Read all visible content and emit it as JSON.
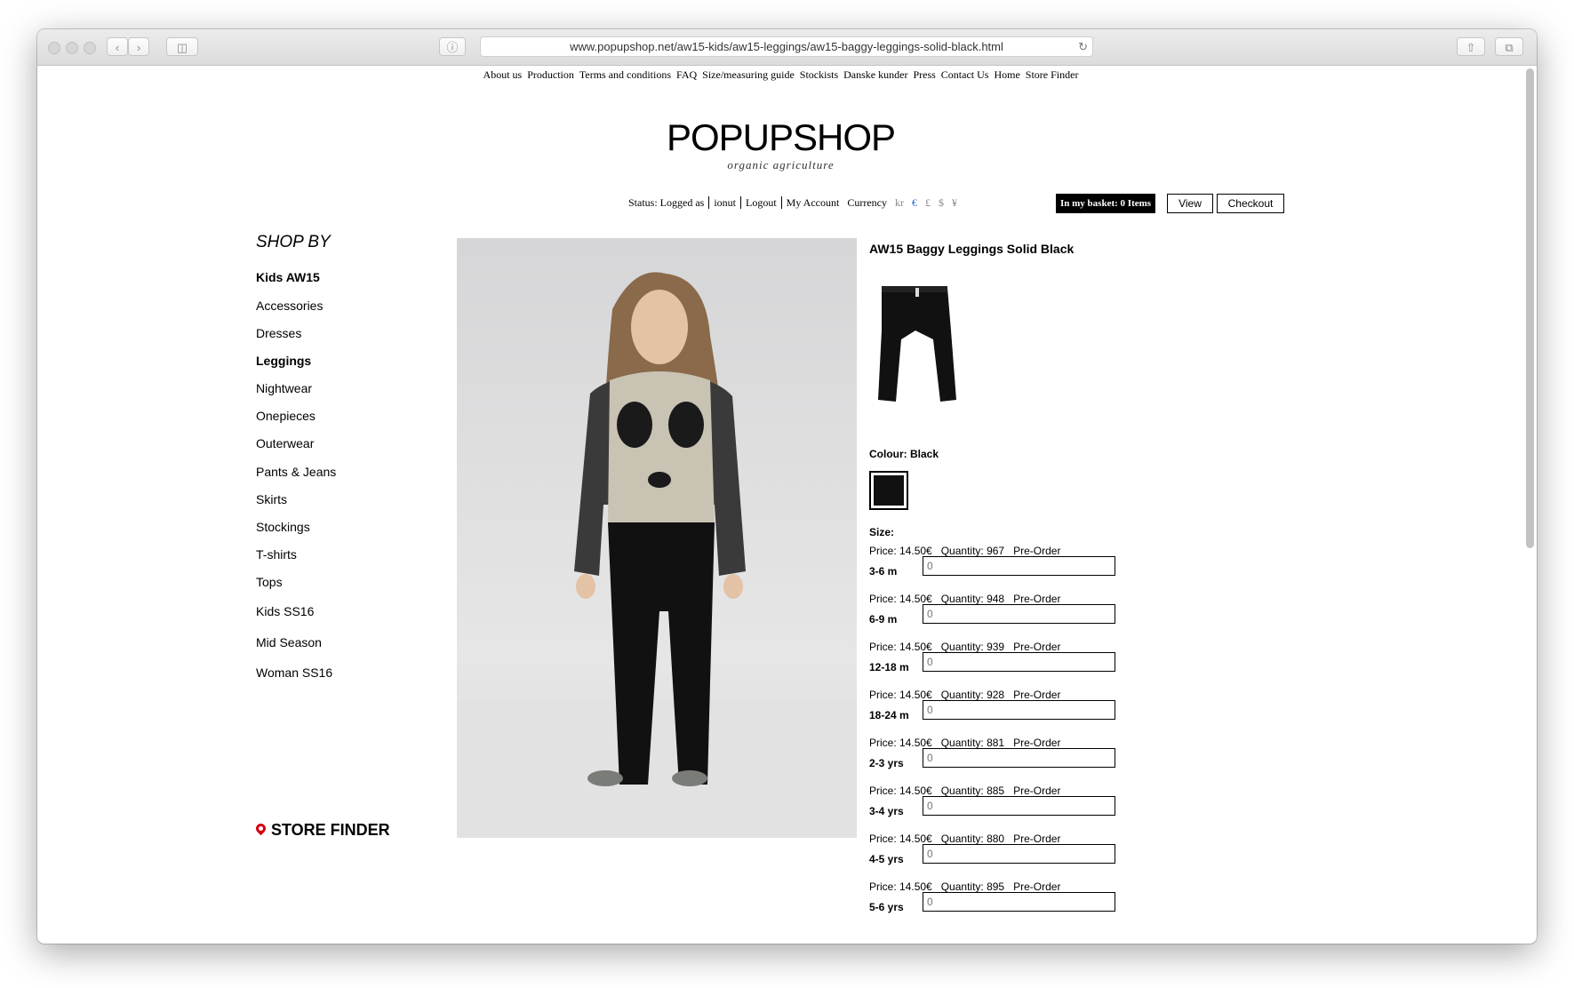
{
  "browser": {
    "url": "www.popupshop.net/aw15-kids/aw15-leggings/aw15-baggy-leggings-solid-black.html"
  },
  "topnav": [
    "About us",
    "Production",
    "Terms and conditions",
    "FAQ",
    "Size/measuring guide",
    "Stockists",
    "Danske kunder",
    "Press",
    "Contact Us",
    "Home",
    "Store Finder"
  ],
  "brand": {
    "logo": "POPUPSHOP",
    "tagline": "organic agriculture"
  },
  "account": {
    "status": "Status: Logged as",
    "user": "ionut",
    "logout": "Logout",
    "my_account": "My Account",
    "currency_label": "Currency",
    "currencies": [
      "kr",
      "€",
      "£",
      "$",
      "¥"
    ],
    "active_currency": "€"
  },
  "basket": {
    "label": "In my basket: 0 Items",
    "view": "View",
    "checkout": "Checkout"
  },
  "sidebar": {
    "heading": "SHOP BY",
    "items": [
      {
        "label": "Kids AW15",
        "bold": true
      },
      {
        "label": "Accessories"
      },
      {
        "label": "Dresses"
      },
      {
        "label": "Leggings",
        "bold": true
      },
      {
        "label": "Nightwear"
      },
      {
        "label": "Onepieces"
      },
      {
        "label": "Outerwear"
      },
      {
        "label": "Pants & Jeans"
      },
      {
        "label": "Skirts"
      },
      {
        "label": "Stockings"
      },
      {
        "label": "T-shirts"
      },
      {
        "label": "Tops"
      },
      {
        "label": "Kids SS16"
      },
      {
        "label": "Mid Season"
      },
      {
        "label": "Woman SS16"
      }
    ],
    "store_finder": "STORE FINDER"
  },
  "product": {
    "title": "AW15 Baggy Leggings Solid Black",
    "colour_label": "Colour: Black",
    "swatch_color": "#111111",
    "size_label": "Size:",
    "sizes": [
      {
        "price": "Price: 14.50€",
        "quantity": "Quantity: 967",
        "status": "Pre-Order",
        "size": "3-6 m",
        "value": "0"
      },
      {
        "price": "Price: 14.50€",
        "quantity": "Quantity: 948",
        "status": "Pre-Order",
        "size": "6-9 m",
        "value": "0"
      },
      {
        "price": "Price: 14.50€",
        "quantity": "Quantity: 939",
        "status": "Pre-Order",
        "size": "12-18 m",
        "value": "0"
      },
      {
        "price": "Price: 14.50€",
        "quantity": "Quantity: 928",
        "status": "Pre-Order",
        "size": "18-24 m",
        "value": "0"
      },
      {
        "price": "Price: 14.50€",
        "quantity": "Quantity: 881",
        "status": "Pre-Order",
        "size": "2-3 yrs",
        "value": "0"
      },
      {
        "price": "Price: 14.50€",
        "quantity": "Quantity: 885",
        "status": "Pre-Order",
        "size": "3-4 yrs",
        "value": "0"
      },
      {
        "price": "Price: 14.50€",
        "quantity": "Quantity: 880",
        "status": "Pre-Order",
        "size": "4-5 yrs",
        "value": "0"
      },
      {
        "price": "Price: 14.50€",
        "quantity": "Quantity: 895",
        "status": "Pre-Order",
        "size": "5-6 yrs",
        "value": "0"
      }
    ]
  }
}
